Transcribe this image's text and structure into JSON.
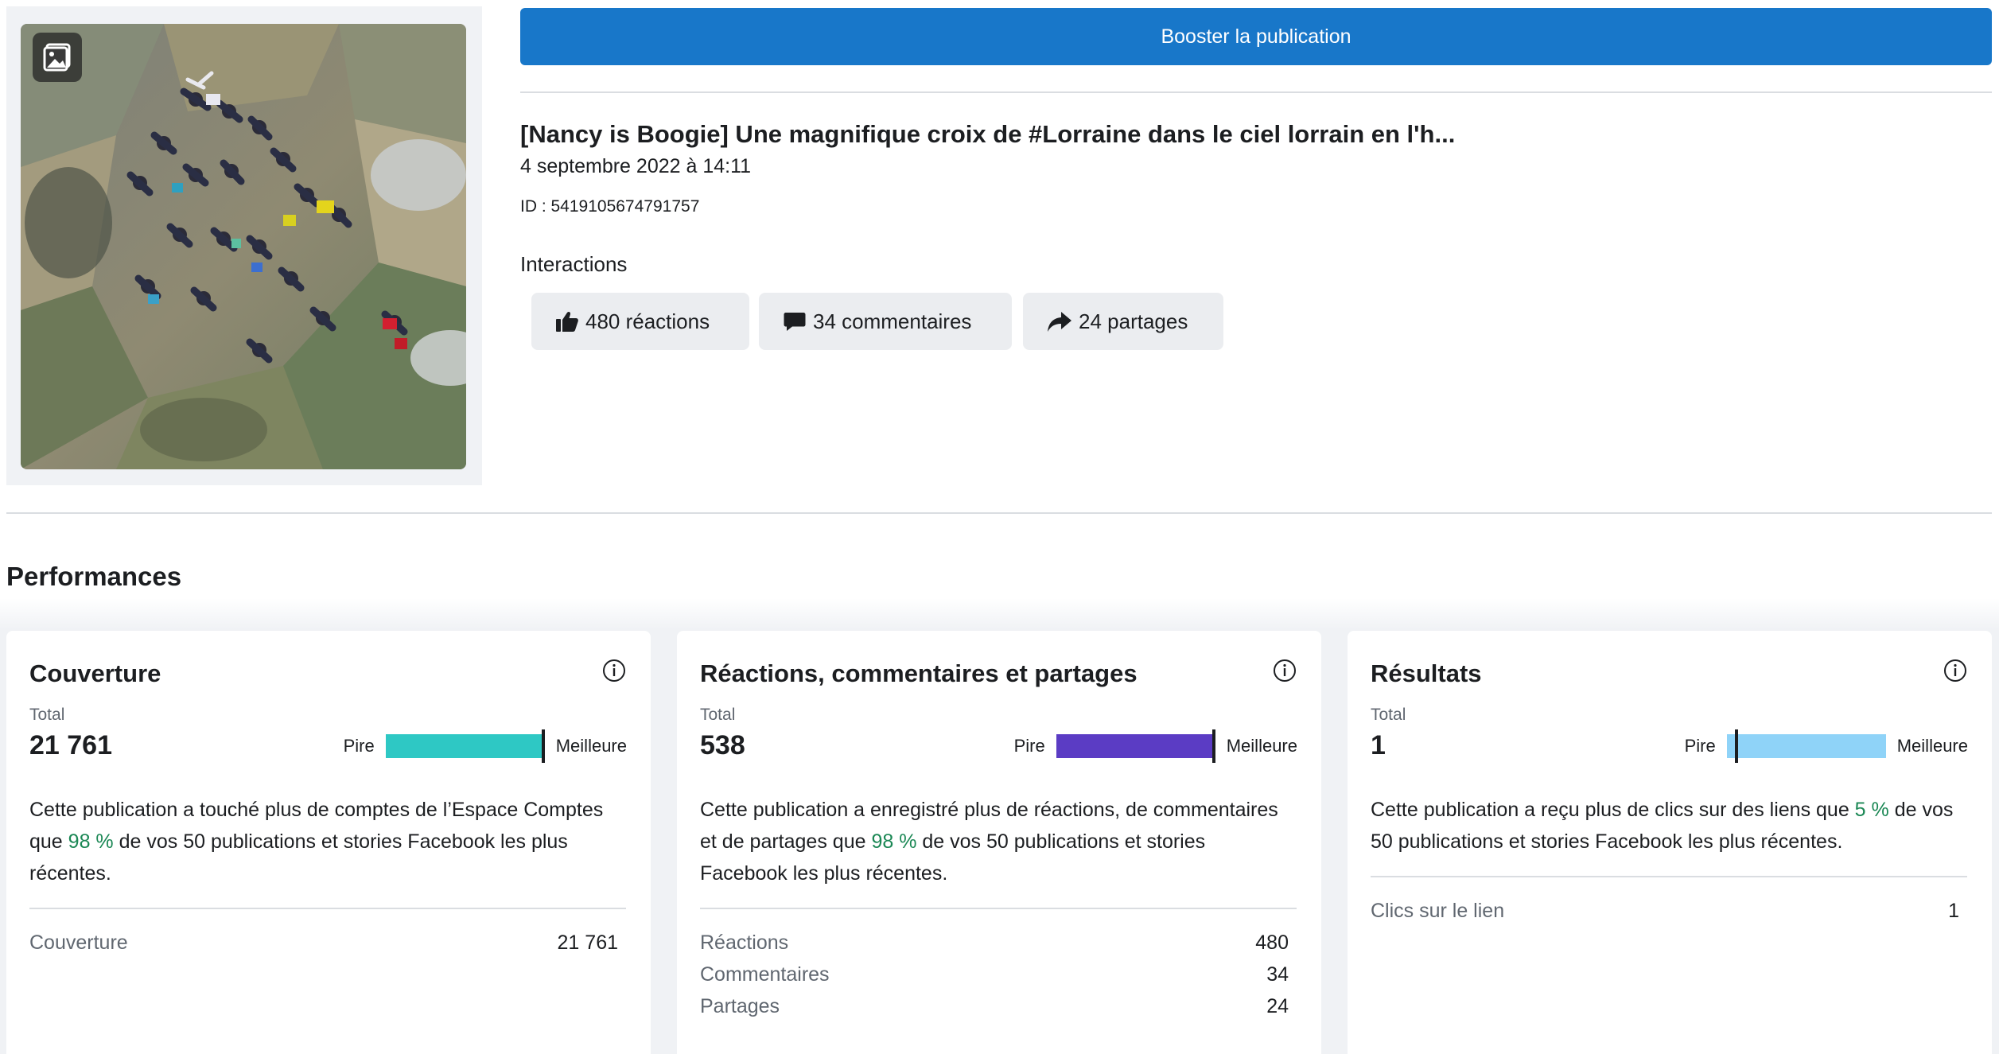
{
  "post": {
    "boost_label": "Booster la publication",
    "title": "[Nancy is Boogie] Une magnifique croix de #Lorraine dans le ciel lorrain en l'h...",
    "date": "4 septembre 2022 à 14:11",
    "id_text": "ID : 5419105674791757",
    "interactions_label": "Interactions",
    "chips": {
      "reactions": "480 réactions",
      "comments": "34 commentaires",
      "shares": "24 partages"
    }
  },
  "performances": {
    "title": "Performances",
    "cards": [
      {
        "title": "Couverture",
        "total_label": "Total",
        "total_value": "21 761",
        "scale_low": "Pire",
        "scale_high": "Meilleure",
        "scale_level": 0.98,
        "scale_color": "#2ec8c4",
        "desc_before": "Cette publication a touché plus de comptes de l’Espace Comptes que ",
        "desc_pct": "98 %",
        "desc_after": " de vos 50 publications et stories Facebook les plus récentes.",
        "metrics": [
          {
            "label": "Couverture",
            "value": "21 761"
          }
        ]
      },
      {
        "title": "Réactions, commentaires et partages",
        "total_label": "Total",
        "total_value": "538",
        "scale_low": "Pire",
        "scale_high": "Meilleure",
        "scale_level": 0.98,
        "scale_color": "#5b3cc4",
        "desc_before": "Cette publication a enregistré plus de réactions, de commentaires et de partages que ",
        "desc_pct": "98 %",
        "desc_after": " de vos 50 publications et stories Facebook les plus récentes.",
        "metrics": [
          {
            "label": "Réactions",
            "value": "480"
          },
          {
            "label": "Commentaires",
            "value": "34"
          },
          {
            "label": "Partages",
            "value": "24"
          }
        ]
      },
      {
        "title": "Résultats",
        "total_label": "Total",
        "total_value": "1",
        "scale_low": "Pire",
        "scale_high": "Meilleure",
        "scale_level": 0.05,
        "scale_color": "#8fd3f8",
        "desc_before": "Cette publication a reçu plus de clics sur des liens que ",
        "desc_pct": "5 %",
        "desc_after": " de vos 50 publications et stories Facebook les plus récentes.",
        "metrics": [
          {
            "label": "Clics sur le lien",
            "value": "1"
          }
        ]
      }
    ]
  },
  "colors": {
    "brand_blue": "#1877c9",
    "percent_green": "#1a8754"
  },
  "icons": [
    "photo-icon",
    "thumbs-up-icon",
    "comment-icon",
    "share-icon",
    "info-icon"
  ]
}
